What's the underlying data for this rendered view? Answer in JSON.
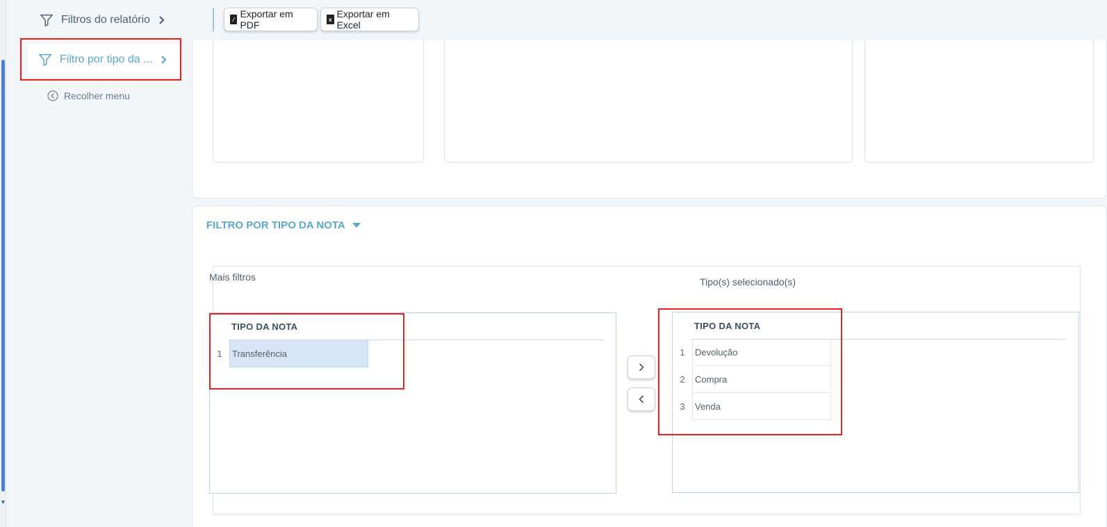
{
  "sidebar": {
    "items": [
      {
        "label": "Filtros do relatório",
        "icon": "filter-icon"
      },
      {
        "label": "Filtro por tipo da ...",
        "icon": "filter-icon"
      }
    ],
    "collapse_label": "Recolher menu"
  },
  "toolbar": {
    "export_pdf_label": "Exportar em PDF",
    "export_excel_label": "Exportar em Excel"
  },
  "filter_section": {
    "title": "FILTRO POR TIPO DA NOTA",
    "more_filters_label": "Mais filtros",
    "selected_label": "Tipo(s) selecionado(s)",
    "available": {
      "header": "TIPO DA NOTA",
      "rows": [
        {
          "num": "1",
          "value": "Transferência",
          "selected": true
        }
      ]
    },
    "chosen": {
      "header": "TIPO DA NOTA",
      "rows": [
        {
          "num": "1",
          "value": "Devolução"
        },
        {
          "num": "2",
          "value": "Compra"
        },
        {
          "num": "3",
          "value": "Venda"
        }
      ]
    }
  },
  "colors": {
    "accent": "#5aa7cf",
    "highlight": "#ee1c1c",
    "selected_row": "#d6e5f7"
  }
}
